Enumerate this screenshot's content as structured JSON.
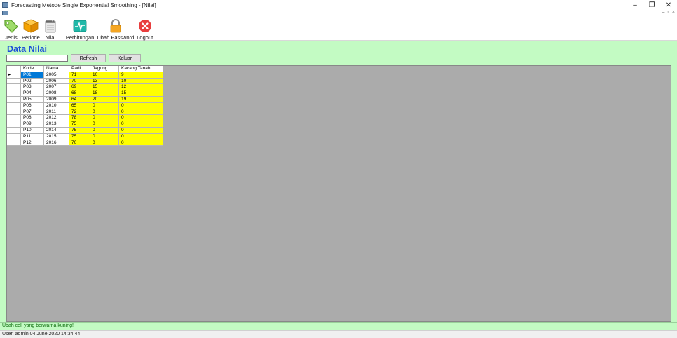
{
  "window": {
    "title": "Forecasting Metode Single Exponential Smoothing - [Nilai]",
    "controls": {
      "minimize": "–",
      "restore": "❐",
      "close": "✕"
    },
    "mdi_controls": {
      "minimize": "–",
      "restore": "▫",
      "close": "×"
    }
  },
  "toolbar": {
    "items": [
      {
        "label": "Jenis",
        "icon": "tag-icon"
      },
      {
        "label": "Periode",
        "icon": "box-icon"
      },
      {
        "label": "Nilai",
        "icon": "notepad-icon"
      },
      {
        "label": "Perhitungan",
        "icon": "pulse-monitor-icon"
      },
      {
        "label": "Ubah Password",
        "icon": "lock-icon"
      },
      {
        "label": "Logout",
        "icon": "close-circle-icon"
      }
    ],
    "colors": {
      "form_bg": "#c3fbc3",
      "title_blue": "#1a4fd8",
      "cell_yellow": "#ffff00",
      "selection": "#0078d7"
    }
  },
  "form": {
    "title": "Data Nilai",
    "search": {
      "value": "",
      "placeholder": ""
    },
    "refresh_label": "Refresh",
    "keluar_label": "Keluar"
  },
  "table": {
    "row_indicator": "▸",
    "columns": [
      "Kode",
      "Nama",
      "Padi",
      "Jagung",
      "Kacang Tanah"
    ],
    "rows": [
      [
        "P01",
        "2005",
        "71",
        "10",
        "9"
      ],
      [
        "P02",
        "2006",
        "70",
        "13",
        "10"
      ],
      [
        "P03",
        "2007",
        "69",
        "15",
        "12"
      ],
      [
        "P04",
        "2008",
        "68",
        "18",
        "15"
      ],
      [
        "P05",
        "2009",
        "64",
        "20",
        "19"
      ],
      [
        "P06",
        "2010",
        "65",
        "0",
        "0"
      ],
      [
        "P07",
        "2011",
        "72",
        "0",
        "0"
      ],
      [
        "P08",
        "2012",
        "78",
        "0",
        "0"
      ],
      [
        "P09",
        "2013",
        "75",
        "0",
        "0"
      ],
      [
        "P10",
        "2014",
        "75",
        "0",
        "0"
      ],
      [
        "P11",
        "2015",
        "75",
        "0",
        "0"
      ],
      [
        "P12",
        "2016",
        "70",
        "0",
        "0"
      ]
    ],
    "selected_row": 0
  },
  "status": {
    "message": "Ubah cell yang berwarna kuning!",
    "user_info": "User: admin  04 June 2020 14:34:44"
  }
}
